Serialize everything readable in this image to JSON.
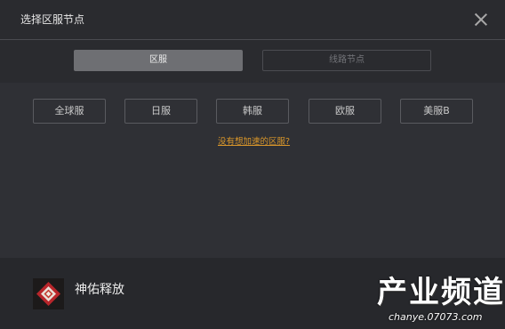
{
  "window": {
    "title": "选择区服节点",
    "close_icon": "close-icon"
  },
  "tabs": [
    {
      "label": "区服",
      "active": true
    },
    {
      "label": "线路节点",
      "active": false
    }
  ],
  "regions": [
    {
      "label": "全球服"
    },
    {
      "label": "日服"
    },
    {
      "label": "韩服"
    },
    {
      "label": "欧服"
    },
    {
      "label": "美服B"
    }
  ],
  "help_link": "没有想加速的区服?",
  "game": {
    "name": "神佑释放",
    "icon": "game-logo-icon"
  },
  "watermark": {
    "main": "产业频道",
    "sub": "chanye.07073.com"
  },
  "colors": {
    "link": "#d9962a",
    "tab_active_bg": "#6e6f73",
    "window_bg": "#2f3035"
  }
}
